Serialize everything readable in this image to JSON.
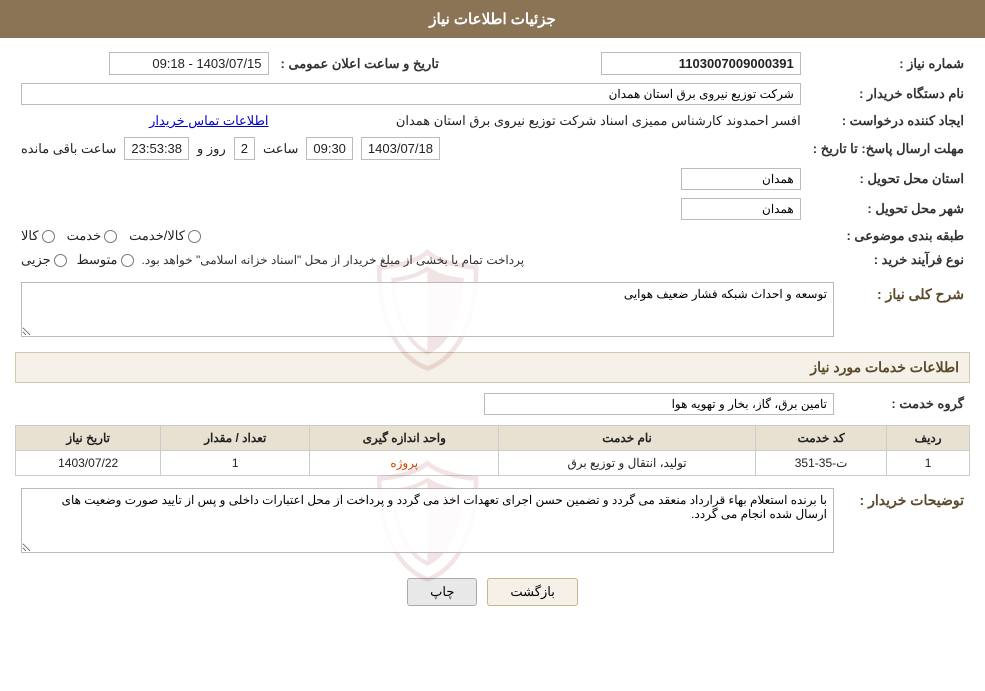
{
  "header": {
    "title": "جزئیات اطلاعات نیاز"
  },
  "fields": {
    "need_number_label": "شماره نیاز :",
    "need_number_value": "1103007009000391",
    "buyer_org_label": "نام دستگاه خریدار :",
    "buyer_org_value": "شرکت توزیع نیروی برق استان همدان",
    "announce_date_label": "تاریخ و ساعت اعلان عمومی :",
    "announce_date_value": "1403/07/15 - 09:18",
    "creator_label": "ایجاد کننده درخواست :",
    "creator_value": "افسر احمدوند کارشناس ممیزی اسناد شرکت توزیع نیروی برق استان همدان",
    "contact_info_link": "اطلاعات تماس خریدار",
    "reply_deadline_label": "مهلت ارسال پاسخ: تا تاریخ :",
    "reply_date": "1403/07/18",
    "reply_time_label": "ساعت",
    "reply_time": "09:30",
    "reply_days_label": "روز و",
    "reply_days": "2",
    "reply_remaining_label": "ساعت باقی مانده",
    "reply_remaining": "23:53:38",
    "delivery_province_label": "استان محل تحویل :",
    "delivery_province": "همدان",
    "delivery_city_label": "شهر محل تحویل :",
    "delivery_city": "همدان",
    "category_label": "طبقه بندی موضوعی :",
    "category_options": [
      "کالا",
      "خدمت",
      "کالا/خدمت"
    ],
    "process_type_label": "نوع فرآیند خرید :",
    "process_options": [
      "جزیی",
      "متوسط"
    ],
    "process_note": "پرداخت تمام یا بخشی از مبلغ خریدار از محل \"اسناد خزانه اسلامی\" خواهد بود.",
    "need_desc_label": "شرح کلی نیاز :",
    "need_desc_value": "توسعه و احداث شبکه فشار ضعیف هوایی",
    "services_section": "اطلاعات خدمات مورد نیاز",
    "service_group_label": "گروه خدمت :",
    "service_group_value": "تامین برق، گاز، بخار و تهویه هوا",
    "table_headers": [
      "ردیف",
      "کد خدمت",
      "نام خدمت",
      "واحد اندازه گیری",
      "تعداد / مقدار",
      "تاریخ نیاز"
    ],
    "table_rows": [
      {
        "row_num": "1",
        "service_code": "ت-35-351",
        "service_name": "تولید، انتقال و توزیع برق",
        "unit": "پروژه",
        "quantity": "1",
        "date": "1403/07/22"
      }
    ],
    "buyer_notes_label": "توضیحات خریدار :",
    "buyer_notes_value": "با برنده استعلام بهاء قرارداد منعقد می گردد و تضمین حسن اجرای تعهدات اخذ می گردد و پرداخت از محل اعتبارات داخلی و پس از تایید صورت وضعیت های ارسال شده انجام می گردد."
  },
  "buttons": {
    "print_label": "چاپ",
    "back_label": "بازگشت"
  }
}
